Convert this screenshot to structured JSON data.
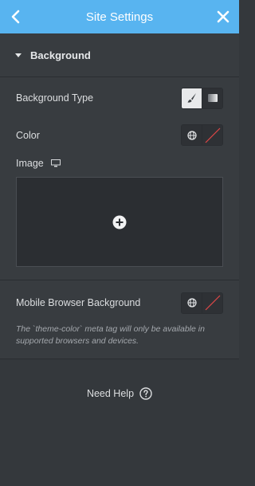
{
  "header": {
    "title": "Site Settings",
    "back_icon": "chevron-left-icon",
    "close_icon": "close-icon"
  },
  "panel": {
    "title": "Background",
    "expanded": true
  },
  "fields": {
    "background_type": {
      "label": "Background Type",
      "options": [
        "classic-brush-icon",
        "gradient-icon"
      ],
      "selected": "classic-brush-icon"
    },
    "color": {
      "label": "Color",
      "icons": [
        "globe-icon",
        "no-color-icon"
      ]
    },
    "image": {
      "label": "Image",
      "device_icon": "desktop-icon",
      "add_icon": "plus-circle-icon"
    },
    "mobile_background": {
      "label": "Mobile Browser Background",
      "icons": [
        "globe-icon",
        "no-color-icon"
      ],
      "note": "The `theme-color` meta tag will only be available in supported browsers and devices."
    }
  },
  "footer": {
    "help_label": "Need Help",
    "help_icon": "question-circle-icon"
  },
  "colors": {
    "header_bg": "#58b4f0",
    "panel_bg": "#383c40",
    "page_bg": "#34383c",
    "no_color_red": "#e04848"
  }
}
